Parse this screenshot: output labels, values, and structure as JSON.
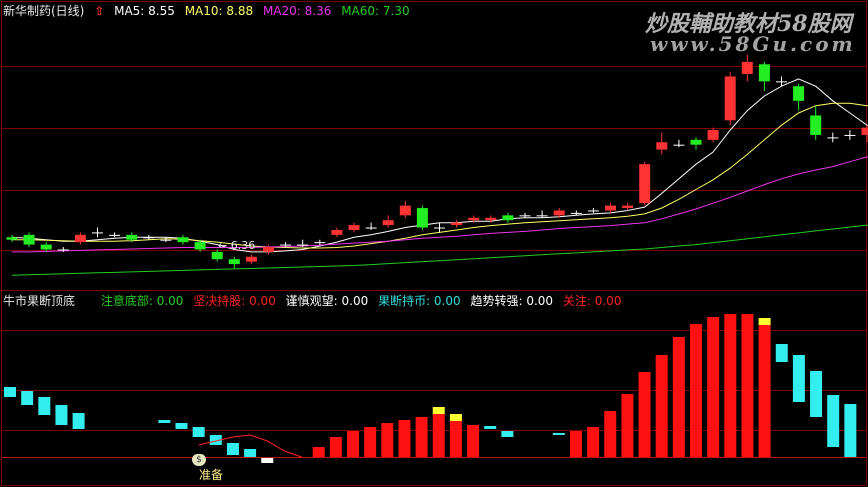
{
  "upper_header": {
    "stock_name": "新华制药(日线)",
    "ma5": "MA5: 8.55",
    "ma10": "MA10: 8.88",
    "ma20": "MA20: 8.36",
    "ma60": "MA60: 7.30"
  },
  "lower_header": {
    "indicator_name": "牛市果断顶底",
    "items": [
      {
        "label": "注意底部: 0.00",
        "color": "#22cc22"
      },
      {
        "label": "坚决持股: 0.00",
        "color": "#ff2222"
      },
      {
        "label": "谨慎观望: 0.00",
        "color": "#ffffff"
      },
      {
        "label": "果断持币: 0.00",
        "color": "#33dddd"
      },
      {
        "label": "趋势转强: 0.00",
        "color": "#ffffff"
      },
      {
        "label": "关注: 0.00",
        "color": "#ff2222"
      }
    ]
  },
  "watermark": {
    "line1": "炒股輔助教材58股网",
    "line2": "www.58Gu.com"
  },
  "annotations": {
    "low_price": "← 6.36",
    "prepare": "准备"
  },
  "colors": {
    "up": "#ff3333",
    "down": "#22ee22",
    "ma5": "#ffffff",
    "ma10": "#ffff66",
    "ma20": "#ee33ee",
    "ma60": "#22cc22",
    "cyan": "#33eeee",
    "yellow": "#ffff33",
    "grid": "#7a0000"
  },
  "chart_data": [
    {
      "type": "candlestick",
      "title": "新华制药(日线)",
      "ylim": [
        6.0,
        11.5
      ],
      "candles": [
        {
          "o": 7.0,
          "c": 6.95,
          "h": 7.05,
          "l": 6.9
        },
        {
          "o": 7.05,
          "c": 6.85,
          "h": 7.1,
          "l": 6.8
        },
        {
          "o": 6.85,
          "c": 6.75,
          "h": 6.9,
          "l": 6.7
        },
        {
          "o": 6.75,
          "c": 6.75,
          "h": 6.8,
          "l": 6.7
        },
        {
          "o": 6.9,
          "c": 7.05,
          "h": 7.1,
          "l": 6.85
        },
        {
          "o": 7.1,
          "c": 7.1,
          "h": 7.2,
          "l": 7.0
        },
        {
          "o": 7.05,
          "c": 7.05,
          "h": 7.1,
          "l": 7.0
        },
        {
          "o": 7.05,
          "c": 6.95,
          "h": 7.1,
          "l": 6.9
        },
        {
          "o": 7.0,
          "c": 7.0,
          "h": 7.05,
          "l": 6.95
        },
        {
          "o": 6.95,
          "c": 6.95,
          "h": 7.0,
          "l": 6.9
        },
        {
          "o": 7.0,
          "c": 6.9,
          "h": 7.05,
          "l": 6.85
        },
        {
          "o": 6.9,
          "c": 6.75,
          "h": 6.95,
          "l": 6.7
        },
        {
          "o": 6.7,
          "c": 6.55,
          "h": 6.75,
          "l": 6.5
        },
        {
          "o": 6.55,
          "c": 6.45,
          "h": 6.6,
          "l": 6.36
        },
        {
          "o": 6.5,
          "c": 6.6,
          "h": 6.65,
          "l": 6.45
        },
        {
          "o": 6.7,
          "c": 6.8,
          "h": 6.85,
          "l": 6.65
        },
        {
          "o": 6.85,
          "c": 6.85,
          "h": 6.9,
          "l": 6.8
        },
        {
          "o": 6.85,
          "c": 6.85,
          "h": 6.95,
          "l": 6.8
        },
        {
          "o": 6.9,
          "c": 6.9,
          "h": 6.95,
          "l": 6.85
        },
        {
          "o": 7.05,
          "c": 7.15,
          "h": 7.2,
          "l": 7.0
        },
        {
          "o": 7.15,
          "c": 7.25,
          "h": 7.3,
          "l": 7.1
        },
        {
          "o": 7.2,
          "c": 7.2,
          "h": 7.3,
          "l": 7.15
        },
        {
          "o": 7.25,
          "c": 7.35,
          "h": 7.45,
          "l": 7.2
        },
        {
          "o": 7.45,
          "c": 7.65,
          "h": 7.75,
          "l": 7.4
        },
        {
          "o": 7.6,
          "c": 7.2,
          "h": 7.65,
          "l": 7.15
        },
        {
          "o": 7.2,
          "c": 7.2,
          "h": 7.3,
          "l": 7.1
        },
        {
          "o": 7.25,
          "c": 7.3,
          "h": 7.35,
          "l": 7.2
        },
        {
          "o": 7.35,
          "c": 7.4,
          "h": 7.45,
          "l": 7.3
        },
        {
          "o": 7.35,
          "c": 7.4,
          "h": 7.45,
          "l": 7.3
        },
        {
          "o": 7.45,
          "c": 7.35,
          "h": 7.5,
          "l": 7.3
        },
        {
          "o": 7.45,
          "c": 7.45,
          "h": 7.5,
          "l": 7.4
        },
        {
          "o": 7.45,
          "c": 7.45,
          "h": 7.55,
          "l": 7.4
        },
        {
          "o": 7.45,
          "c": 7.55,
          "h": 7.6,
          "l": 7.4
        },
        {
          "o": 7.5,
          "c": 7.5,
          "h": 7.55,
          "l": 7.45
        },
        {
          "o": 7.55,
          "c": 7.55,
          "h": 7.6,
          "l": 7.5
        },
        {
          "o": 7.55,
          "c": 7.65,
          "h": 7.7,
          "l": 7.5
        },
        {
          "o": 7.6,
          "c": 7.65,
          "h": 7.7,
          "l": 7.55
        },
        {
          "o": 7.7,
          "c": 8.5,
          "h": 8.55,
          "l": 7.65
        },
        {
          "o": 8.8,
          "c": 8.95,
          "h": 9.15,
          "l": 8.7
        },
        {
          "o": 8.9,
          "c": 8.9,
          "h": 9.0,
          "l": 8.85
        },
        {
          "o": 9.0,
          "c": 8.9,
          "h": 9.05,
          "l": 8.8
        },
        {
          "o": 9.0,
          "c": 9.2,
          "h": 9.25,
          "l": 8.95
        },
        {
          "o": 9.4,
          "c": 10.3,
          "h": 10.4,
          "l": 9.3
        },
        {
          "o": 10.35,
          "c": 10.6,
          "h": 10.75,
          "l": 10.2
        },
        {
          "o": 10.55,
          "c": 10.2,
          "h": 10.6,
          "l": 10.0
        },
        {
          "o": 10.2,
          "c": 10.2,
          "h": 10.3,
          "l": 10.1
        },
        {
          "o": 10.1,
          "c": 9.8,
          "h": 10.15,
          "l": 9.6
        },
        {
          "o": 9.5,
          "c": 9.1,
          "h": 9.7,
          "l": 9.0
        },
        {
          "o": 9.05,
          "c": 9.05,
          "h": 9.15,
          "l": 8.95
        },
        {
          "o": 9.1,
          "c": 9.1,
          "h": 9.2,
          "l": 9.0
        },
        {
          "o": 9.1,
          "c": 9.25,
          "h": 9.3,
          "l": 8.95
        },
        {
          "o": 9.35,
          "c": 9.55,
          "h": 9.6,
          "l": 9.3
        }
      ],
      "series": [
        {
          "name": "MA5",
          "values": [
            7.0,
            6.98,
            6.95,
            6.92,
            6.92,
            6.95,
            6.98,
            7.0,
            7.0,
            7.0,
            6.98,
            6.92,
            6.85,
            6.75,
            6.7,
            6.7,
            6.72,
            6.75,
            6.82,
            6.9,
            7.0,
            7.05,
            7.12,
            7.2,
            7.25,
            7.3,
            7.3,
            7.33,
            7.33,
            7.38,
            7.4,
            7.4,
            7.42,
            7.45,
            7.48,
            7.5,
            7.55,
            7.62,
            7.9,
            8.2,
            8.5,
            8.75,
            9.2,
            9.6,
            9.9,
            10.1,
            10.25,
            10.1,
            9.8,
            9.55,
            9.3,
            9.25
          ]
        },
        {
          "name": "MA10",
          "values": [
            6.95,
            6.95,
            6.94,
            6.93,
            6.92,
            6.92,
            6.92,
            6.93,
            6.95,
            6.97,
            6.96,
            6.93,
            6.9,
            6.86,
            6.82,
            6.8,
            6.79,
            6.78,
            6.78,
            6.79,
            6.82,
            6.87,
            6.92,
            6.98,
            7.05,
            7.1,
            7.15,
            7.2,
            7.24,
            7.27,
            7.3,
            7.32,
            7.34,
            7.36,
            7.38,
            7.4,
            7.43,
            7.48,
            7.6,
            7.78,
            7.98,
            8.18,
            8.42,
            8.7,
            9.0,
            9.3,
            9.55,
            9.7,
            9.75,
            9.75,
            9.7,
            9.65
          ]
        },
        {
          "name": "MA20",
          "values": [
            6.7,
            6.7,
            6.71,
            6.72,
            6.73,
            6.74,
            6.75,
            6.76,
            6.77,
            6.78,
            6.79,
            6.79,
            6.79,
            6.79,
            6.79,
            6.8,
            6.81,
            6.82,
            6.84,
            6.86,
            6.88,
            6.9,
            6.92,
            6.95,
            6.98,
            7.0,
            7.02,
            7.05,
            7.08,
            7.1,
            7.12,
            7.15,
            7.18,
            7.2,
            7.22,
            7.24,
            7.27,
            7.3,
            7.38,
            7.48,
            7.58,
            7.7,
            7.82,
            7.95,
            8.08,
            8.2,
            8.3,
            8.38,
            8.45,
            8.55,
            8.65,
            8.8
          ]
        },
        {
          "name": "MA60",
          "values": [
            6.22,
            6.23,
            6.24,
            6.25,
            6.26,
            6.27,
            6.28,
            6.29,
            6.3,
            6.31,
            6.32,
            6.33,
            6.34,
            6.35,
            6.36,
            6.37,
            6.38,
            6.39,
            6.4,
            6.41,
            6.42,
            6.44,
            6.46,
            6.48,
            6.5,
            6.52,
            6.54,
            6.56,
            6.58,
            6.6,
            6.62,
            6.64,
            6.66,
            6.68,
            6.7,
            6.72,
            6.74,
            6.76,
            6.79,
            6.82,
            6.85,
            6.89,
            6.93,
            6.97,
            7.01,
            7.05,
            7.09,
            7.13,
            7.17,
            7.21,
            7.25,
            7.3
          ]
        }
      ]
    },
    {
      "type": "bar",
      "title": "牛市果断顶底",
      "ylim": [
        0,
        100
      ],
      "bars": [
        {
          "k": "cyan",
          "lo": 60,
          "hi": 70
        },
        {
          "k": "cyan",
          "lo": 52,
          "hi": 66
        },
        {
          "k": "cyan",
          "lo": 42,
          "hi": 60
        },
        {
          "k": "cyan",
          "lo": 32,
          "hi": 52
        },
        {
          "k": "cyan",
          "lo": 28,
          "hi": 44
        },
        {
          "k": "none"
        },
        {
          "k": "none"
        },
        {
          "k": "none"
        },
        {
          "k": "none"
        },
        {
          "k": "cyan",
          "lo": 34,
          "hi": 37
        },
        {
          "k": "cyan",
          "lo": 28,
          "hi": 34
        },
        {
          "k": "cyan",
          "lo": 20,
          "hi": 30
        },
        {
          "k": "cyan",
          "lo": 12,
          "hi": 22
        },
        {
          "k": "cyan",
          "lo": 2,
          "hi": 14
        },
        {
          "k": "cyan",
          "lo": 0,
          "hi": 8
        },
        {
          "k": "white",
          "lo": -6,
          "hi": 0
        },
        {
          "k": "none"
        },
        {
          "k": "none"
        },
        {
          "k": "red",
          "lo": 0,
          "hi": 10
        },
        {
          "k": "red",
          "lo": 0,
          "hi": 20
        },
        {
          "k": "red",
          "lo": 0,
          "hi": 26
        },
        {
          "k": "red",
          "lo": 0,
          "hi": 30
        },
        {
          "k": "red",
          "lo": 0,
          "hi": 34
        },
        {
          "k": "red",
          "lo": 0,
          "hi": 37
        },
        {
          "k": "red",
          "lo": 0,
          "hi": 40
        },
        {
          "k": "red",
          "lo": 0,
          "hi": 43,
          "y": "top"
        },
        {
          "k": "red",
          "lo": 0,
          "hi": 36,
          "y": "top"
        },
        {
          "k": "red",
          "lo": 0,
          "hi": 32
        },
        {
          "k": "cyan",
          "lo": 28,
          "hi": 31
        },
        {
          "k": "cyan",
          "lo": 20,
          "hi": 26
        },
        {
          "k": "none"
        },
        {
          "k": "none"
        },
        {
          "k": "cyan",
          "lo": 22,
          "hi": 24
        },
        {
          "k": "red",
          "lo": 0,
          "hi": 26
        },
        {
          "k": "red",
          "lo": 0,
          "hi": 30
        },
        {
          "k": "red",
          "lo": 0,
          "hi": 46
        },
        {
          "k": "red",
          "lo": 0,
          "hi": 63
        },
        {
          "k": "red",
          "lo": 0,
          "hi": 85
        },
        {
          "k": "red",
          "lo": 0,
          "hi": 102
        },
        {
          "k": "red",
          "lo": 0,
          "hi": 120
        },
        {
          "k": "red",
          "lo": 0,
          "hi": 133
        },
        {
          "k": "red",
          "lo": 0,
          "hi": 140
        },
        {
          "k": "red",
          "lo": 0,
          "hi": 143
        },
        {
          "k": "red",
          "lo": 0,
          "hi": 143
        },
        {
          "k": "red",
          "lo": 0,
          "hi": 132,
          "y": "top"
        },
        {
          "k": "cyan",
          "lo": 95,
          "hi": 113
        },
        {
          "k": "cyan",
          "lo": 55,
          "hi": 102
        },
        {
          "k": "cyan",
          "lo": 40,
          "hi": 86
        },
        {
          "k": "cyan",
          "lo": 10,
          "hi": 62
        },
        {
          "k": "cyan",
          "lo": 0,
          "hi": 53
        }
      ],
      "line": [
        null,
        null,
        null,
        null,
        null,
        null,
        null,
        null,
        null,
        null,
        null,
        12,
        16,
        20,
        22,
        16,
        6,
        0,
        null,
        null,
        null,
        null,
        null,
        null,
        null,
        null,
        null,
        null,
        null,
        null,
        null,
        null,
        null,
        null,
        null,
        null,
        null,
        null,
        null,
        null,
        null,
        null,
        null,
        null,
        null,
        null,
        null,
        null,
        null,
        null
      ]
    }
  ]
}
